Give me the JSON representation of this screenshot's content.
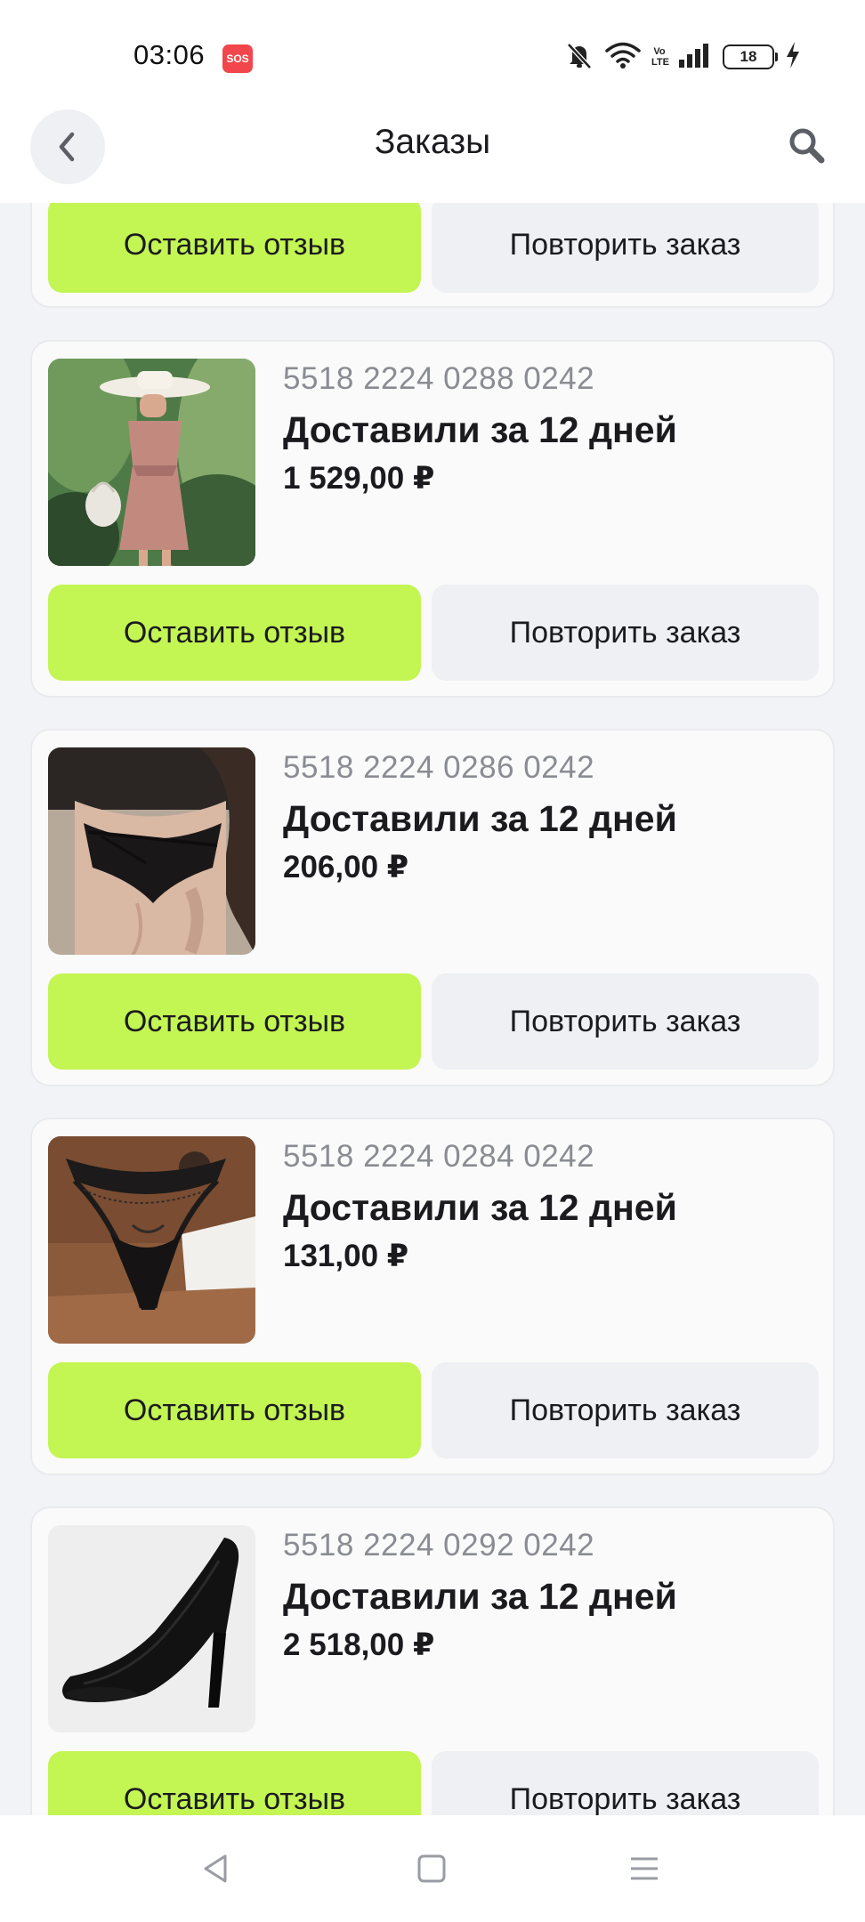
{
  "status_bar": {
    "time": "03:06",
    "sos": "SOS",
    "volte": "Vo LTE",
    "battery": "18"
  },
  "header": {
    "title": "Заказы",
    "back_icon": "chevron-left-icon",
    "search_icon": "search-icon"
  },
  "actions": {
    "review_label": "Оставить отзыв",
    "repeat_label": "Повторить заказ"
  },
  "orders": [
    {
      "number": "5518 2224 0288 0242",
      "status": "Доставили за 12 дней",
      "price": "1 529,00 ₽",
      "product_image": "woman-in-pink-dress-with-sun-hat-photo"
    },
    {
      "number": "5518 2224 0286 0242",
      "status": "Доставили за 12 дней",
      "price": "206,00 ₽",
      "product_image": "black-lace-underwear-photo"
    },
    {
      "number": "5518 2224 0284 0242",
      "status": "Доставили за 12 дней",
      "price": "131,00 ₽",
      "product_image": "black-fishnet-thong-photo"
    },
    {
      "number": "5518 2224 0292 0242",
      "status": "Доставили за 12 дней",
      "price": "2 518,00 ₽",
      "product_image": "black-high-heel-pump-photo"
    }
  ],
  "nav": {
    "back": "triangle-back-icon",
    "home": "square-home-icon",
    "menu": "hamburger-menu-icon"
  },
  "colors": {
    "accent": "#c3f553",
    "secondary_button": "#eef0f4",
    "muted_text": "#8a8c93",
    "background": "#f2f3f6"
  }
}
